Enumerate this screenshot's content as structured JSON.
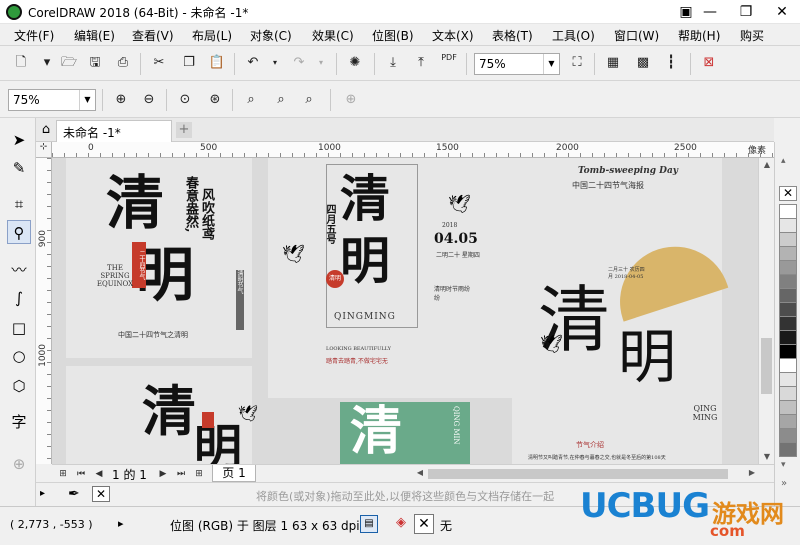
{
  "window": {
    "title": "CorelDRAW 2018 (64-Bit) - 未命名 -1*",
    "minimize": "—",
    "restore": "❐",
    "close": "✕"
  },
  "menu": [
    "文件(F)",
    "编辑(E)",
    "查看(V)",
    "布局(L)",
    "对象(C)",
    "效果(C)",
    "位图(B)",
    "文本(X)",
    "表格(T)",
    "工具(O)",
    "窗口(W)",
    "帮助(H)",
    "购买"
  ],
  "standard_toolbar": {
    "zoom_value": "75%",
    "pdf_label": "PDF"
  },
  "property_bar": {
    "zoom_value": "75%"
  },
  "document_tab": {
    "label": "未命名 -1*",
    "add": "+"
  },
  "rulers": {
    "corner": "⊹",
    "h_ticks": [
      "0",
      "500",
      "1000",
      "1500",
      "2000",
      "2500"
    ],
    "h_unit": "像素",
    "v_ticks": [
      "900",
      "1000"
    ]
  },
  "posters": {
    "p1": {
      "big1": "清",
      "big2": "明",
      "poem1": "春意盎然,",
      "poem2": "风吹纸鸢",
      "seal": "二十四节气",
      "en": "THE SPRING EQUINOX",
      "foot": "中国二十四节气之清明",
      "side": "清明节气"
    },
    "p2": {
      "big": "清",
      "big2": "明"
    },
    "p3": {
      "big1": "清",
      "big2": "明",
      "side": "四月五号",
      "date": "04.05",
      "year": "2018",
      "day": "二明二十 星期四",
      "en": "QINGMING",
      "seal": "清明",
      "note": "清明时节雨纷纷",
      "foot1": "LOOKING BEAUTIFULLY",
      "foot2": "踏青去踏青,不做宅宅无",
      "bar": "QING MIN"
    },
    "p4": {
      "en_title": "Tomb-sweeping Day",
      "cn_title": "中国二十四节气海报",
      "big1": "清",
      "big2": "明",
      "en": "QING MING",
      "ribbon": "节气介绍",
      "foot": "清明节又叫踏青节,在仲春与暮春之交,也就是冬至后的第108天",
      "stamp": "二月三十 农历四月 2018-04-05"
    }
  },
  "page_nav": {
    "page_of": "1 的 1",
    "page_tab": "页 1"
  },
  "doc_palette": {
    "hint": "将颜色(或对象)拖动至此处,以便将这些颜色与文档存储在一起"
  },
  "status": {
    "coords": "( 2,773 , -553  )",
    "info": "位图 (RGB) 于 图层 1 63 x 63 dpi",
    "fill": "无"
  },
  "watermark": {
    "brand": "UCBUG",
    "game": "游戏网",
    "domain": "com"
  },
  "palette_colors": [
    "#ffffff",
    "#e6e6e6",
    "#cccccc",
    "#b3b3b3",
    "#999999",
    "#808080",
    "#666666",
    "#4d4d4d",
    "#333333",
    "#1a1a1a",
    "#000000",
    "#ffffff",
    "#e6e6e6",
    "#d9d9d9",
    "#c0c0c0",
    "#a6a6a6",
    "#8c8c8c",
    "#737373"
  ],
  "tool_icons": [
    "pick-tool-icon",
    "shape-tool-icon",
    "crop-tool-icon",
    "zoom-tool-icon",
    "freehand-tool-icon",
    "artistic-media-tool-icon",
    "rectangle-tool-icon",
    "ellipse-tool-icon",
    "polygon-tool-icon",
    "text-tool-icon",
    "add-tool-icon"
  ]
}
